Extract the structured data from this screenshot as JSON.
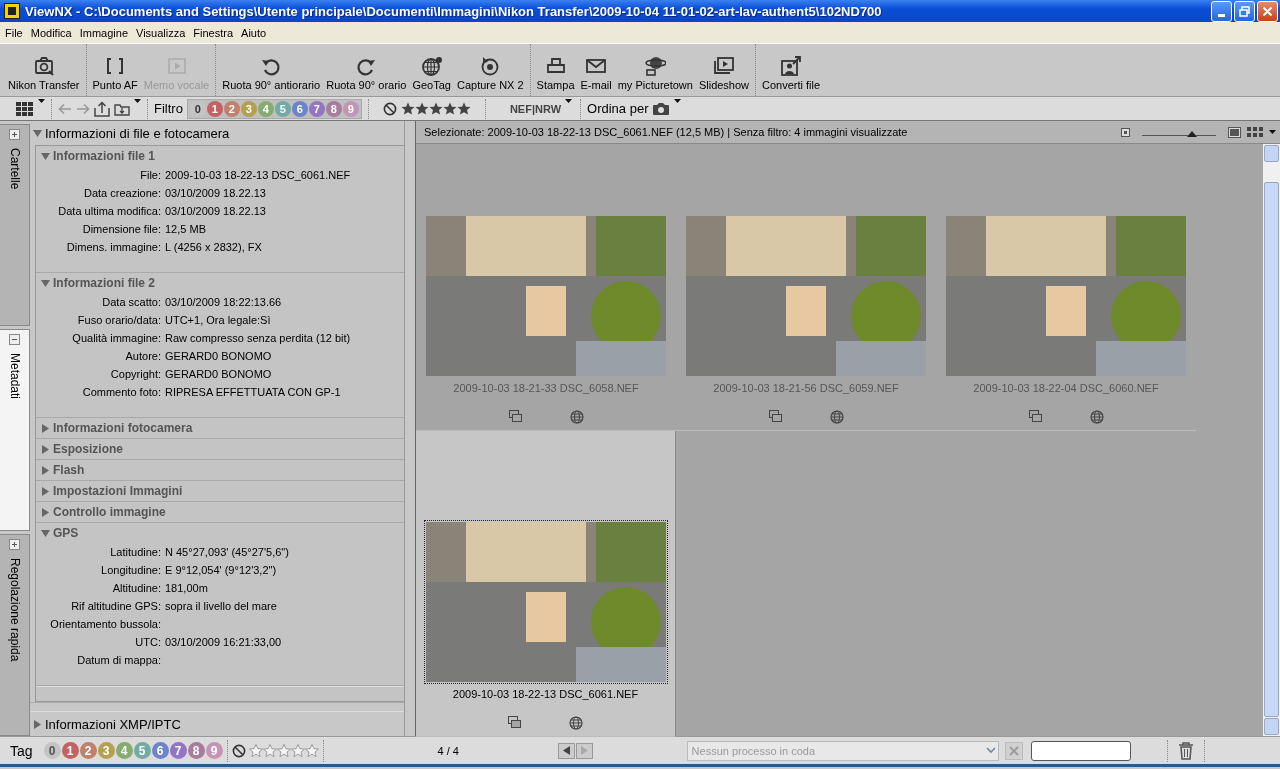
{
  "window": {
    "title": "ViewNX - C:\\Documents and Settings\\Utente principale\\Documenti\\Immagini\\Nikon Transfer\\2009-10-04 11-01-02-art-lav-authent5\\102ND700"
  },
  "menu": [
    "File",
    "Modifica",
    "Immagine",
    "Visualizza",
    "Finestra",
    "Aiuto"
  ],
  "toolbar": [
    {
      "buttons": [
        {
          "label": "Nikon Transfer",
          "disabled": false
        }
      ]
    },
    {
      "buttons": [
        {
          "label": "Punto AF",
          "disabled": false
        },
        {
          "label": "Memo vocale",
          "disabled": true
        }
      ]
    },
    {
      "buttons": [
        {
          "label": "Ruota 90° antiorario",
          "disabled": false
        },
        {
          "label": "Ruota 90° orario",
          "disabled": false
        },
        {
          "label": "GeoTag",
          "disabled": false
        },
        {
          "label": "Capture NX 2",
          "disabled": false
        }
      ]
    },
    {
      "buttons": [
        {
          "label": "Stampa",
          "disabled": false
        },
        {
          "label": "E-mail",
          "disabled": false
        },
        {
          "label": "my Picturetown",
          "disabled": false
        },
        {
          "label": "Slideshow",
          "disabled": false
        }
      ]
    },
    {
      "buttons": [
        {
          "label": "Converti file",
          "disabled": false
        }
      ]
    }
  ],
  "filter_bar": {
    "label": "Filtro",
    "labels": [
      {
        "label": "0",
        "color": "#c4c4c4"
      },
      {
        "label": "1",
        "color": "#c46262"
      },
      {
        "label": "2",
        "color": "#c0806c"
      },
      {
        "label": "3",
        "color": "#b4a050"
      },
      {
        "label": "4",
        "color": "#86ac70"
      },
      {
        "label": "5",
        "color": "#72aaa4"
      },
      {
        "label": "6",
        "color": "#6c84cc"
      },
      {
        "label": "7",
        "color": "#9474c4"
      },
      {
        "label": "8",
        "color": "#a87c9c"
      },
      {
        "label": "9",
        "color": "#c494b4"
      }
    ],
    "rating_filter": {
      "stars": 5
    },
    "raw_filter": "NEF|NRW",
    "sort_label": "Ordina per"
  },
  "side_tabs": [
    {
      "label": "Cartelle",
      "selected": false
    },
    {
      "label": "Metadati",
      "selected": true
    },
    {
      "label": "Regolazione rapida",
      "selected": false
    }
  ],
  "metadata": {
    "groups": [
      {
        "title": "Informazioni di file e fotocamera",
        "expanded": true,
        "sections": [
          {
            "title": "Informazioni file 1",
            "expanded": true,
            "rows": [
              {
                "label": "File:",
                "value": "2009-10-03 18-22-13 DSC_6061.NEF"
              },
              {
                "label": "Data creazione:",
                "value": "03/10/2009 18.22.13"
              },
              {
                "label": "Data ultima modifica:",
                "value": "03/10/2009 18.22.13"
              },
              {
                "label": "Dimensione file:",
                "value": "12,5 MB"
              },
              {
                "label": "Dimens. immagine:",
                "value": "L (4256 x 2832), FX"
              }
            ]
          },
          {
            "title": "Informazioni file 2",
            "expanded": true,
            "rows": [
              {
                "label": "Data scatto:",
                "value": "03/10/2009 18:22:13.66"
              },
              {
                "label": "Fuso orario/data:",
                "value": "UTC+1, Ora legale:Sì"
              },
              {
                "label": "Qualità immagine:",
                "value": "Raw compresso senza perdita (12 bit)"
              },
              {
                "label": "Autore:",
                "value": "GERARD0 BONOMO"
              },
              {
                "label": "Copyright:",
                "value": "GERARD0 BONOMO"
              },
              {
                "label": "Commento foto:",
                "value": "RIPRESA EFFETTUATA CON GP-1"
              }
            ]
          },
          {
            "title": "Informazioni fotocamera",
            "expanded": false
          },
          {
            "title": "Esposizione",
            "expanded": false
          },
          {
            "title": "Flash",
            "expanded": false
          },
          {
            "title": "Impostazioni Immagini",
            "expanded": false
          },
          {
            "title": "Controllo immagine",
            "expanded": false
          },
          {
            "title": "GPS",
            "expanded": true,
            "rows": [
              {
                "label": "Latitudine:",
                "value": "N 45°27,093' (45°27'5,6\")"
              },
              {
                "label": "Longitudine:",
                "value": "E 9°12,054' (9°12'3,2\")"
              },
              {
                "label": "Altitudine:",
                "value": "181,00m"
              },
              {
                "label": "Rif altitudine GPS:",
                "value": "sopra il livello del mare"
              },
              {
                "label": "Orientamento bussola:"
              },
              {
                "label": "UTC:",
                "value": "03/10/2009 16:21:33,00"
              },
              {
                "label": "Datum di mappa:"
              }
            ]
          }
        ]
      },
      {
        "title": "Informazioni XMP/IPTC",
        "expanded": false
      }
    ]
  },
  "browser": {
    "status": "Selezionate: 2009-10-03 18-22-13 DSC_6061.NEF (12,5 MB) | Senza filtro: 4 immagini visualizzate",
    "thumb_size": {
      "level": 0.67
    },
    "thumbnails": [
      {
        "name": "2009-10-03 18-21-33 DSC_6058.NEF",
        "selected": false
      },
      {
        "name": "2009-10-03 18-21-56 DSC_6059.NEF",
        "selected": false
      },
      {
        "name": "2009-10-03 18-22-04 DSC_6060.NEF",
        "selected": false
      },
      {
        "name": "2009-10-03 18-22-13 DSC_6061.NEF",
        "selected": true
      }
    ]
  },
  "bottom_bar": {
    "label": "Tag",
    "labels": [
      {
        "label": "0",
        "color": "#c4c4c4"
      },
      {
        "label": "1",
        "color": "#c46262"
      },
      {
        "label": "2",
        "color": "#c0806c"
      },
      {
        "label": "3",
        "color": "#b4a050"
      },
      {
        "label": "4",
        "color": "#86ac70"
      },
      {
        "label": "5",
        "color": "#72aaa4"
      },
      {
        "label": "6",
        "color": "#6c84cc"
      },
      {
        "label": "7",
        "color": "#9474c4"
      },
      {
        "label": "8",
        "color": "#a87c9c"
      },
      {
        "label": "9",
        "color": "#c494b4"
      }
    ],
    "rating": {
      "stars": 0
    },
    "count": "4 / 4",
    "queue": {
      "placeholder": "Nessun processo in coda"
    }
  }
}
